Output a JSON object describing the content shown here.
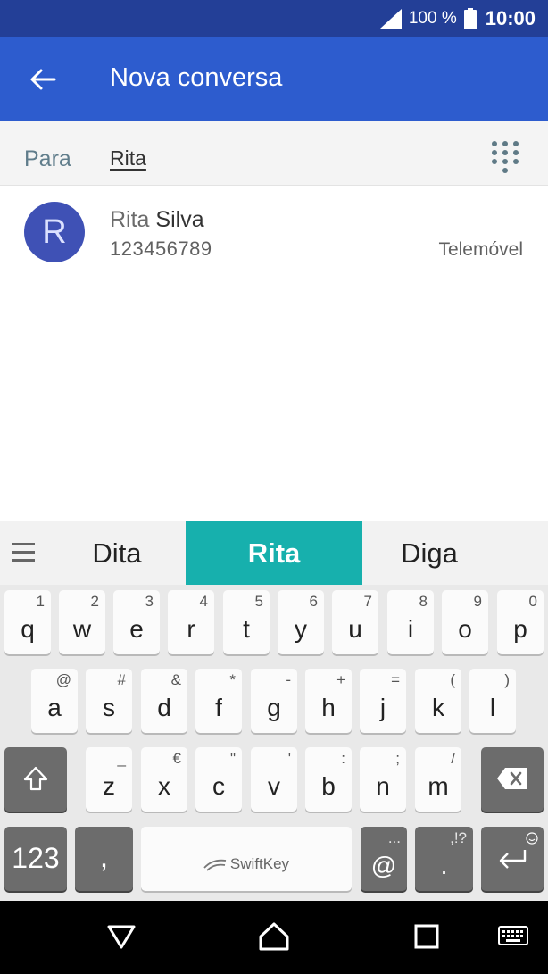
{
  "status_bar": {
    "battery_percent": "100 %",
    "time": "10:00",
    "icons": [
      "signal-icon",
      "battery-icon"
    ]
  },
  "app_bar": {
    "title": "Nova conversa",
    "back_icon": "back-arrow-icon"
  },
  "recipient": {
    "to_label": "Para",
    "input_value": "Rita",
    "dialpad_icon": "dialpad-icon"
  },
  "suggestion_contact": {
    "avatar_letter": "R",
    "name_match": "Rita",
    "name_rest": " Silva",
    "number": "123456789",
    "type": "Telemóvel",
    "avatar_color": "#3f51b5"
  },
  "keyboard": {
    "suggestions": [
      "Dita",
      "Rita",
      "Diga"
    ],
    "row1": [
      {
        "key": "q",
        "sub": "1"
      },
      {
        "key": "w",
        "sub": "2"
      },
      {
        "key": "e",
        "sub": "3"
      },
      {
        "key": "r",
        "sub": "4"
      },
      {
        "key": "t",
        "sub": "5"
      },
      {
        "key": "y",
        "sub": "6"
      },
      {
        "key": "u",
        "sub": "7"
      },
      {
        "key": "i",
        "sub": "8"
      },
      {
        "key": "o",
        "sub": "9"
      },
      {
        "key": "p",
        "sub": "0"
      }
    ],
    "row2": [
      {
        "key": "a",
        "sub": "@"
      },
      {
        "key": "s",
        "sub": "#"
      },
      {
        "key": "d",
        "sub": "&"
      },
      {
        "key": "f",
        "sub": "*"
      },
      {
        "key": "g",
        "sub": "-"
      },
      {
        "key": "h",
        "sub": "+"
      },
      {
        "key": "j",
        "sub": "="
      },
      {
        "key": "k",
        "sub": "("
      },
      {
        "key": "l",
        "sub": ")"
      }
    ],
    "row3": [
      {
        "key": "z",
        "sub": "_"
      },
      {
        "key": "x",
        "sub": "€"
      },
      {
        "key": "c",
        "sub": "\""
      },
      {
        "key": "v",
        "sub": "'"
      },
      {
        "key": "b",
        "sub": ":"
      },
      {
        "key": "n",
        "sub": ";"
      },
      {
        "key": "m",
        "sub": "/"
      }
    ],
    "numbers_key": "123",
    "comma_key": ",",
    "space_brand": "SwiftKey",
    "at_key": "@",
    "at_sub": "...",
    "period_key": ".",
    "period_sub": ",!?",
    "accent_color": "#17b0ad"
  },
  "nav_bar": {
    "icons": [
      "back-triangle-icon",
      "home-icon",
      "recents-icon",
      "keyboard-switch-icon"
    ]
  }
}
